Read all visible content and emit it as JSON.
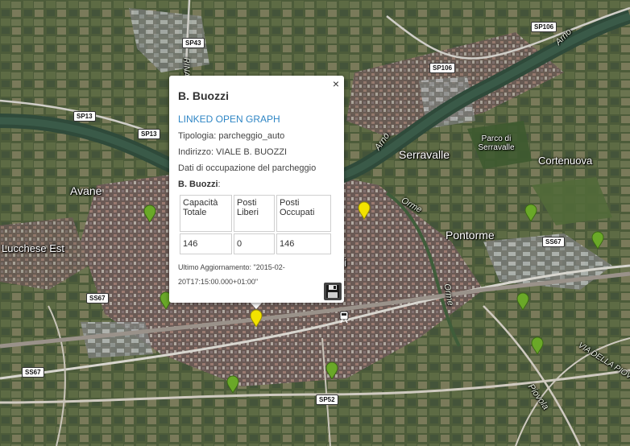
{
  "map": {
    "labels": [
      {
        "id": "avane",
        "text": "Avane"
      },
      {
        "id": "serravalle",
        "text": "Serravalle"
      },
      {
        "id": "pontorme",
        "text": "Pontorme"
      },
      {
        "id": "cortenuova",
        "text": "Cortenuova"
      },
      {
        "id": "lucchese",
        "text": "Lucchese Est"
      },
      {
        "id": "parco",
        "text": "Parco di Serravalle"
      },
      {
        "id": "arno1",
        "text": "Arno"
      },
      {
        "id": "arno2",
        "text": "Arno"
      },
      {
        "id": "orme1",
        "text": "Orme"
      },
      {
        "id": "orme2",
        "text": "Orme"
      },
      {
        "id": "piovola",
        "text": "Piovola"
      },
      {
        "id": "viapiov",
        "text": "VIA DELLA PIOVO"
      },
      {
        "id": "rina",
        "text": "RINA"
      },
      {
        "id": "i_frag",
        "text": "i"
      }
    ],
    "shields": [
      "SP43",
      "SP106",
      "SP106",
      "SP13",
      "SP13",
      "SS67",
      "SS67",
      "SS67",
      "SP52"
    ],
    "marker_colors": {
      "green": "#6aa828",
      "yellow": "#f3e300"
    }
  },
  "popup": {
    "close": "×",
    "title": "B. Buozzi",
    "link": "LINKED OPEN GRAPH",
    "tipologia": "Tipologia: parcheggio_auto",
    "indirizzo": "Indirizzo: VIALE B. BUOZZI",
    "dati": "Dati di occupazione del parcheggio",
    "name_bold": "B. Buozzi",
    "name_suffix": ":",
    "headers": [
      "Capacità Totale",
      "Posti Liberi",
      "Posti Occupati"
    ],
    "values": [
      "146",
      "0",
      "146"
    ],
    "update": "Ultimo Aggiornamento: \"2015-02-20T17:15:00.000+01:00\""
  }
}
